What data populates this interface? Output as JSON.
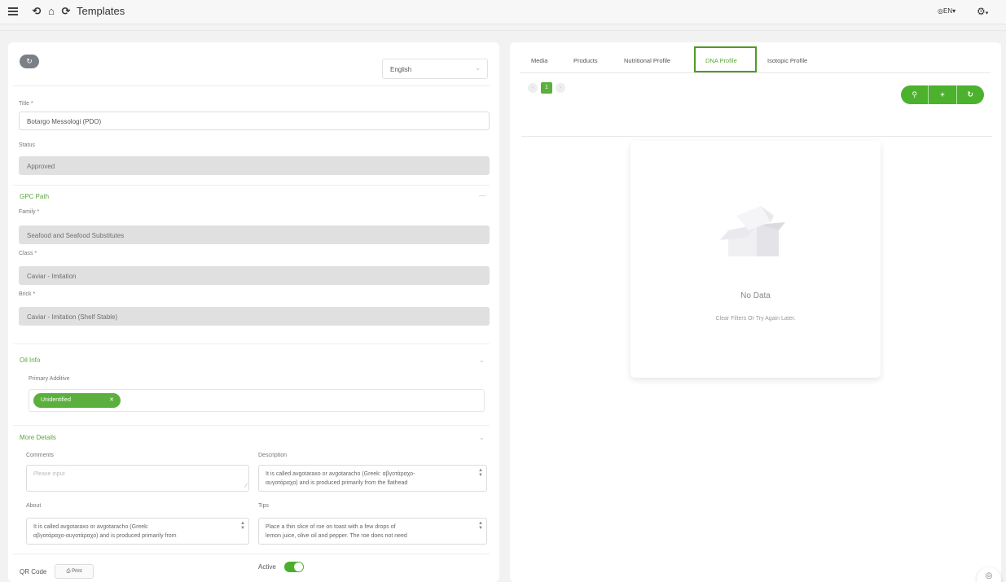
{
  "header": {
    "title": "Templates",
    "lang": "EN",
    "nav_icons": [
      "back-icon",
      "home-icon",
      "forward-icon"
    ]
  },
  "form": {
    "language": "English",
    "title_label": "Title *",
    "title_value": "Botargo Messologi (PDO)",
    "status_label": "Status",
    "status_value": "Approved",
    "gpc_section": "GPC Path",
    "family_label": "Family *",
    "family_value": "Seafood and Seafood Substitutes",
    "class_label": "Class *",
    "class_value": "Caviar - Imitation",
    "brick_label": "Brick *",
    "brick_value": "Caviar - Imitation (Shelf Stable)",
    "oil_section": "Oil Info",
    "primary_additive_label": "Primary Additive",
    "primary_additive_tag": "Unidentified",
    "more_section": "More Details",
    "comments_label": "Comments",
    "comments_placeholder": "Please input",
    "description_label": "Description",
    "description_line1": "It is called avgotaraxo or avgotaracho (Greek: αβγοτάραχο-",
    "description_line2": "αυγοτάραχο) and is produced primarily from the flathead",
    "about_label": "About",
    "about_line1": "It is called avgotaraxo or avgotaracho (Greek:",
    "about_line2": "αβγοτάραχο-αυγοτάραχο) and is produced primarily from",
    "tips_label": "Tips",
    "tips_line1": "Place a thin slice of roe on toast with a few drops of",
    "tips_line2": "lemon juice, olive oil and pepper. The roe does not need",
    "qr_label": "QR Code",
    "print_label": "Print",
    "active_label": "Active",
    "active": true
  },
  "tabs": {
    "media": "Media",
    "products": "Products",
    "nutritional": "Nutritional Profile",
    "dna": "DNA Profile",
    "isotopic": "Isotopic Profile",
    "active": "DNA Profile"
  },
  "pagination": {
    "current": "1"
  },
  "empty": {
    "title": "No Data",
    "subtitle": "Clear Filters Or Try Again Later."
  },
  "colors": {
    "accent": "#5bb03d",
    "highlight_border": "#4f9a27"
  }
}
